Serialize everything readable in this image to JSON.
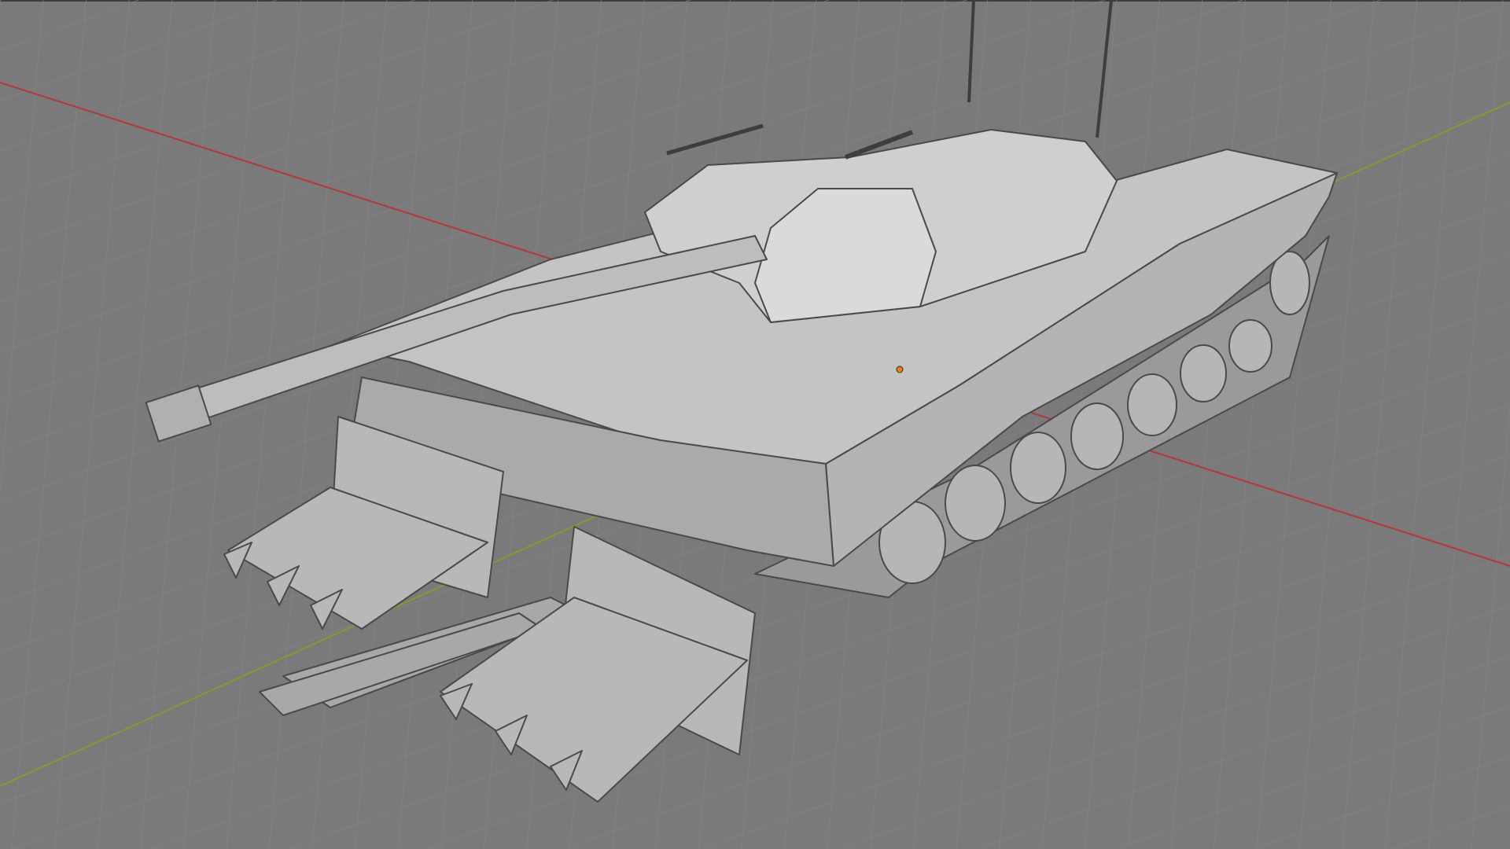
{
  "app": {
    "viewport_mode": "wireframe-solid",
    "background_color": "#7a7a7a",
    "grid_color": "#858585",
    "x_axis_color": "#b33a3a",
    "y_axis_color": "#7f9a2f",
    "origin_marker_color": "#e8821a"
  },
  "scene": {
    "object": "tank-model",
    "parts": [
      "hull",
      "turret",
      "main-gun",
      "antenna",
      "antenna",
      "mine-plow-left",
      "mine-plow-right",
      "road-wheels",
      "track",
      "side-skirt"
    ]
  }
}
